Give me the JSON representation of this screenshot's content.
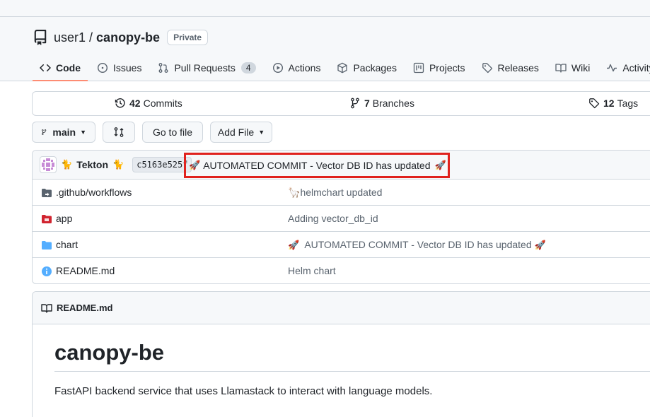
{
  "repo": {
    "owner": "user1",
    "separator": "/",
    "name": "canopy-be",
    "visibility": "Private"
  },
  "tabs": [
    {
      "label": "Code",
      "icon": "code-icon",
      "active": true
    },
    {
      "label": "Issues",
      "icon": "issue-icon"
    },
    {
      "label": "Pull Requests",
      "icon": "pull-request-icon",
      "count": "4"
    },
    {
      "label": "Actions",
      "icon": "actions-play-icon"
    },
    {
      "label": "Packages",
      "icon": "package-icon"
    },
    {
      "label": "Projects",
      "icon": "project-icon"
    },
    {
      "label": "Releases",
      "icon": "tag-icon"
    },
    {
      "label": "Wiki",
      "icon": "book-icon"
    },
    {
      "label": "Activity",
      "icon": "pulse-icon"
    }
  ],
  "stats": {
    "commits_count": "42",
    "commits_label": "Commits",
    "branches_count": "7",
    "branches_label": "Branches",
    "tags_count": "12",
    "tags_label": "Tags"
  },
  "toolbar": {
    "branch": "main",
    "go_to_file": "Go to file",
    "add_file": "Add File"
  },
  "latest_commit": {
    "author": "Tekton",
    "sha": "c5163e525f",
    "message": "AUTOMATED COMMIT - Vector DB ID has updated"
  },
  "files": [
    {
      "name_prefix": ".github/",
      "name": "workflows",
      "type": "folder-dark",
      "message": "helmchart updated"
    },
    {
      "name_prefix": "",
      "name": "app",
      "type": "folder-red",
      "message": "Adding vector_db_id"
    },
    {
      "name_prefix": "",
      "name": "chart",
      "type": "folder-blue",
      "message": "AUTOMATED COMMIT - Vector DB ID has updated"
    },
    {
      "name_prefix": "",
      "name": "README.md",
      "type": "info",
      "message": "Helm chart"
    }
  ],
  "readme": {
    "header": "README.md",
    "title": "canopy-be",
    "description": "FastAPI backend service that uses Llamastack to interact with language models."
  },
  "colors": {
    "highlight_border": "#e0221e",
    "active_tab_underline": "#fd8c73",
    "folder_blue": "#54aeff",
    "folder_red": "#d1242f"
  }
}
